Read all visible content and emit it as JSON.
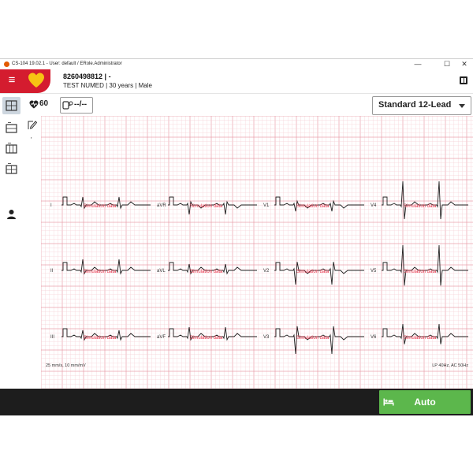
{
  "window": {
    "title": "CS-104 19.02.1 - User: default / ERole.Administrator",
    "minimize_glyph": "—",
    "maximize_glyph": "☐",
    "close_glyph": "✕"
  },
  "header": {
    "menu_glyph": "≡",
    "patient_id": "8260498812 | -",
    "patient_info": "TEST NUMED | 30 years | Male",
    "brand_color": "#d41c2f",
    "logo_color": "#f7c313"
  },
  "sidebar": {
    "items": [
      {
        "name": "ecg-12-lead",
        "active": true
      },
      {
        "name": "ecg-1x12"
      },
      {
        "name": "ecg-3x4"
      },
      {
        "name": "ecg-6x2"
      },
      {
        "name": "user"
      }
    ]
  },
  "toolbar": {
    "heart_rate": "60",
    "blood_pressure": "--/--",
    "mode": "Standard 12-Lead"
  },
  "tools": {
    "tick_marker": "'"
  },
  "ecg": {
    "grid_minor_color": "#f6d2d8",
    "grid_major_color": "#eaa0ab",
    "trace_color": "#202020",
    "watermark_color": "#e8334a",
    "watermark": "Simulation data",
    "rows": [
      {
        "leads": [
          "I",
          "aVR",
          "V1",
          "V4"
        ]
      },
      {
        "leads": [
          "II",
          "aVL",
          "V2",
          "V5"
        ]
      },
      {
        "leads": [
          "III",
          "aVF",
          "V3",
          "V6"
        ]
      }
    ],
    "info_left": "25 mm/s, 10 mm/mV",
    "info_right": "LP 40Hz, AC 50Hz",
    "rhythm": {
      "lead": "I",
      "info_left": "25 mm/s, 10 mm/mV",
      "info_right": "LP 40Hz, AC 50Hz"
    }
  },
  "footer": {
    "auto_label": "Auto",
    "auto_color": "#5cb74c"
  }
}
